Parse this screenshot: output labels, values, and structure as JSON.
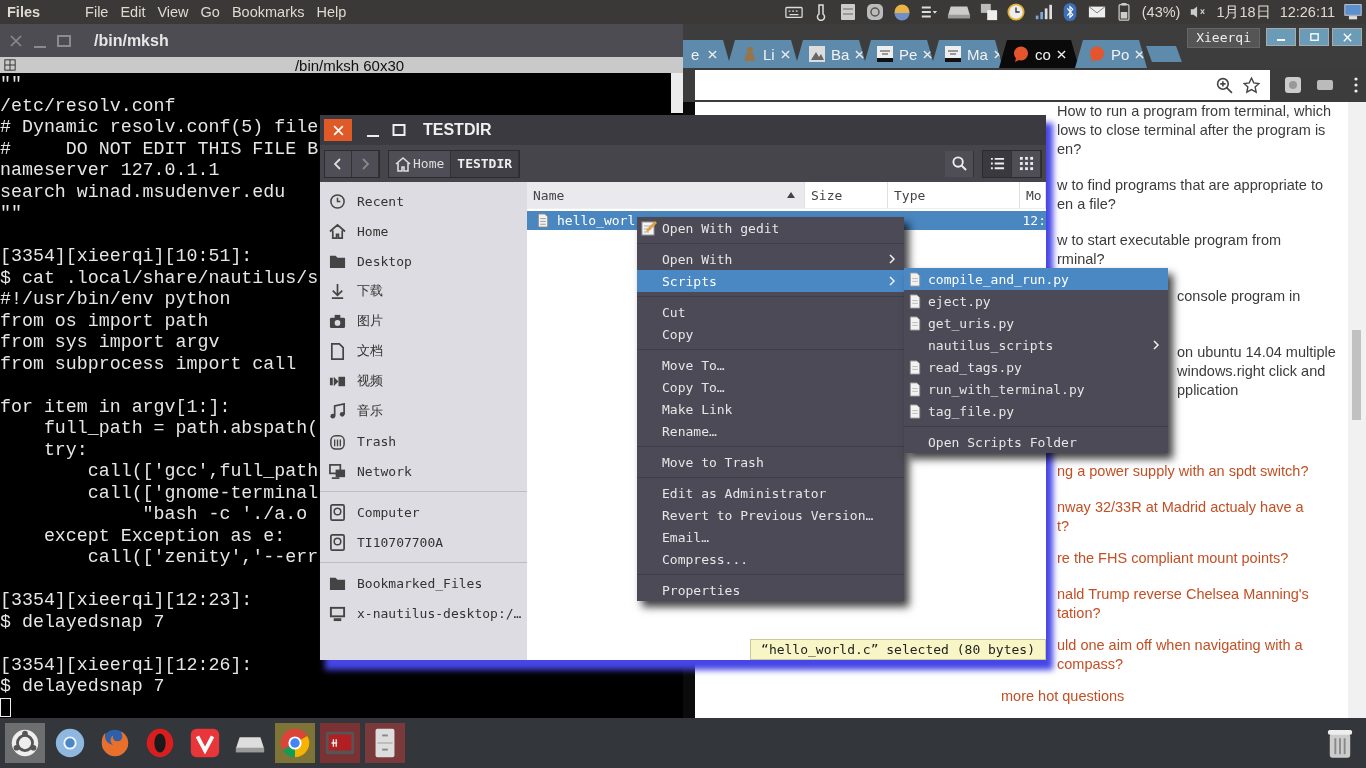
{
  "top_panel": {
    "app_name": "Files",
    "menus": [
      "File",
      "Edit",
      "View",
      "Go",
      "Bookmarks",
      "Help"
    ],
    "battery": "(43%)",
    "date": "1月18日",
    "time": "12:26:11"
  },
  "terminal": {
    "title": "/bin/mksh",
    "subtitle": "/bin/mksh 60x30",
    "blocks": [
      [
        "\"\"",
        "/etc/resolv.conf",
        "# Dynamic resolv.conf(5) file",
        "#     DO NOT EDIT THIS FILE B",
        "nameserver 127.0.1.1",
        "search winad.msudenver.edu",
        "\"\""
      ],
      [
        "[3354][xieerqi][10:51]:",
        "$ cat .local/share/nautilus/s",
        "#!/usr/bin/env python",
        "from os import path",
        "from sys import argv",
        "from subprocess import call"
      ],
      [
        "for item in argv[1:]:",
        "    full_path = path.abspath(",
        "    try:",
        "        call(['gcc',full_path",
        "        call(['gnome-terminal",
        "             \"bash -c './a.o",
        "    except Exception as e:",
        "        call(['zenity','--err"
      ],
      [
        "[3354][xieerqi][12:23]:",
        "$ delayedsnap 7"
      ],
      [
        "[3354][xieerqi][12:26]:",
        "$ delayedsnap 7"
      ]
    ]
  },
  "browser": {
    "user": "Xieerqi",
    "tabs": [
      {
        "label": "e",
        "kind": "none",
        "selected": false
      },
      {
        "label": "Li",
        "kind": "figure",
        "selected": false
      },
      {
        "label": "Ba",
        "kind": "picture",
        "selected": false
      },
      {
        "label": "Pe",
        "kind": "page",
        "selected": false
      },
      {
        "label": "Ma",
        "kind": "page",
        "selected": false
      },
      {
        "label": "co",
        "kind": "ask",
        "selected": true
      },
      {
        "label": "Po",
        "kind": "ask",
        "selected": false
      }
    ],
    "questions": [
      {
        "kind": "related",
        "lines": [
          "How to run a program from terminal, which",
          "lows to close terminal after the program is",
          "en?"
        ]
      },
      {
        "kind": "related",
        "lines": [
          "w to find programs that are appropriate to",
          "en a file?"
        ]
      },
      {
        "kind": "related",
        "lines": [
          "w to start executable program from",
          "rminal?"
        ]
      },
      {
        "kind": "related",
        "lines": [
          "console program in"
        ]
      },
      {
        "kind": "related",
        "lines": [
          "on ubuntu 14.04 multiple",
          "windows.right click and",
          "pplication"
        ]
      },
      {
        "kind": "hot",
        "lines": [
          "ng a power supply with an spdt switch?"
        ]
      },
      {
        "kind": "hot",
        "lines": [
          "nway 32/33R at Madrid actualy have a",
          "t?"
        ]
      },
      {
        "kind": "hot",
        "lines": [
          "re the FHS compliant mount points?"
        ]
      },
      {
        "kind": "hot",
        "lines": [
          "nald Trump reverse Chelsea Manning's",
          "tation?"
        ]
      },
      {
        "kind": "hot",
        "lines": [
          "uld one aim off when navigating with a",
          "compass?"
        ]
      }
    ],
    "more_link": "more hot questions"
  },
  "file_manager": {
    "title": "TESTDIR",
    "path": [
      {
        "label": "Home",
        "selected": false
      },
      {
        "label": "TESTDIR",
        "selected": true
      }
    ],
    "views": [
      {
        "kind": "list",
        "selected": true
      },
      {
        "kind": "grid",
        "selected": false
      }
    ],
    "places": [
      [
        {
          "kind": "recent",
          "label": "Recent"
        },
        {
          "kind": "home",
          "label": "Home"
        },
        {
          "kind": "folder",
          "label": "Desktop"
        },
        {
          "kind": "download",
          "label": "下载"
        },
        {
          "kind": "camera",
          "label": "图片"
        },
        {
          "kind": "document",
          "label": "文档"
        },
        {
          "kind": "video",
          "label": "视频"
        },
        {
          "kind": "music",
          "label": "音乐"
        },
        {
          "kind": "trash",
          "label": "Trash"
        },
        {
          "kind": "network",
          "label": "Network"
        }
      ],
      [
        {
          "kind": "drive",
          "label": "Computer"
        },
        {
          "kind": "drive",
          "label": "TI10707700A"
        }
      ],
      [
        {
          "kind": "folder",
          "label": "Bookmarked_Files"
        },
        {
          "kind": "desktop",
          "label": "x-nautilus-desktop:/…"
        }
      ]
    ],
    "columns": [
      {
        "label": "Name",
        "sorted": true
      },
      {
        "label": "Size",
        "sorted": false
      },
      {
        "label": "Type",
        "sorted": false
      },
      {
        "label": "Mo",
        "sorted": false
      }
    ],
    "rows": [
      {
        "name": "hello_worl",
        "modified": "12:",
        "selected": true
      }
    ],
    "status": "“hello_world.c” selected (80 bytes)"
  },
  "context_menu": {
    "groups": [
      [
        {
          "label": "Open With gedit",
          "kind": "app",
          "submenu": false,
          "selected": false
        }
      ],
      [
        {
          "label": "Open With",
          "kind": "plain",
          "submenu": true,
          "selected": false
        },
        {
          "label": "Scripts",
          "kind": "plain",
          "submenu": true,
          "selected": true
        }
      ],
      [
        {
          "label": "Cut",
          "kind": "plain",
          "submenu": false,
          "selected": false
        },
        {
          "label": "Copy",
          "kind": "plain",
          "submenu": false,
          "selected": false
        }
      ],
      [
        {
          "label": "Move To…",
          "kind": "plain",
          "submenu": false,
          "selected": false
        },
        {
          "label": "Copy To…",
          "kind": "plain",
          "submenu": false,
          "selected": false
        },
        {
          "label": "Make Link",
          "kind": "plain",
          "submenu": false,
          "selected": false
        },
        {
          "label": "Rename…",
          "kind": "plain",
          "submenu": false,
          "selected": false
        }
      ],
      [
        {
          "label": "Move to Trash",
          "kind": "plain",
          "submenu": false,
          "selected": false
        }
      ],
      [
        {
          "label": "Edit as Administrator",
          "kind": "plain",
          "submenu": false,
          "selected": false
        },
        {
          "label": "Revert to Previous Version…",
          "kind": "plain",
          "submenu": false,
          "selected": false
        },
        {
          "label": "Email…",
          "kind": "plain",
          "submenu": false,
          "selected": false
        },
        {
          "label": "Compress...",
          "kind": "plain",
          "submenu": false,
          "selected": false
        }
      ],
      [
        {
          "label": "Properties",
          "kind": "plain",
          "submenu": false,
          "selected": false
        }
      ]
    ]
  },
  "scripts_menu": {
    "groups": [
      [
        {
          "label": "compile_and_run.py",
          "kind": "file",
          "submenu": false,
          "selected": true
        },
        {
          "label": "eject.py",
          "kind": "file",
          "submenu": false,
          "selected": false
        },
        {
          "label": "get_uris.py",
          "kind": "file",
          "submenu": false,
          "selected": false
        },
        {
          "label": "nautilus_scripts",
          "kind": "plain",
          "submenu": true,
          "selected": false
        },
        {
          "label": "read_tags.py",
          "kind": "file",
          "submenu": false,
          "selected": false
        },
        {
          "label": "run_with_terminal.py",
          "kind": "file",
          "submenu": false,
          "selected": false
        },
        {
          "label": "tag_file.py",
          "kind": "file",
          "submenu": false,
          "selected": false
        }
      ],
      [
        {
          "label": "Open Scripts Folder",
          "kind": "plain",
          "submenu": false,
          "selected": false
        }
      ]
    ]
  },
  "dock": [
    {
      "kind": "ubuntu",
      "running": false
    },
    {
      "kind": "chromium",
      "running": false
    },
    {
      "kind": "firefox",
      "running": false
    },
    {
      "kind": "opera",
      "running": false
    },
    {
      "kind": "vivaldi",
      "running": false
    },
    {
      "kind": "drive",
      "running": false
    },
    {
      "kind": "chrome",
      "running": true
    },
    {
      "kind": "terminal",
      "running": true
    },
    {
      "kind": "cabinet",
      "running": true
    }
  ]
}
